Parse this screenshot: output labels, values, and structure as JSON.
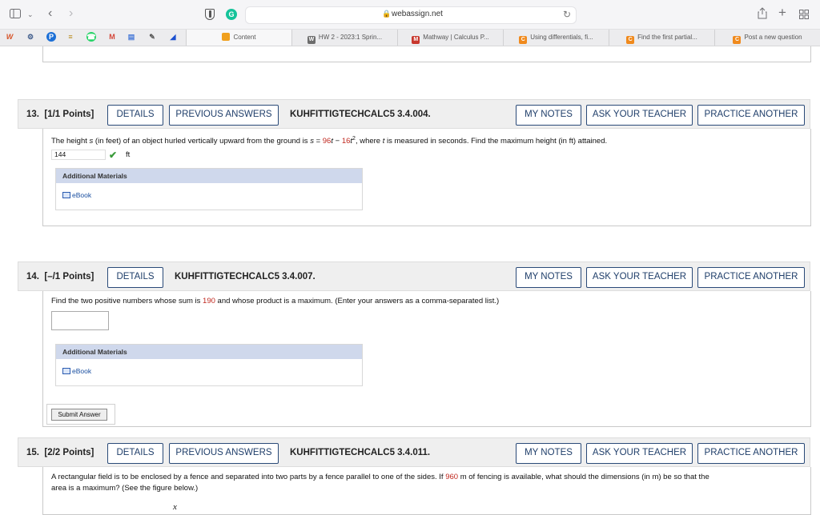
{
  "browser": {
    "url": "webassign.net",
    "tabs": [
      {
        "label": "Content",
        "favicon": "D",
        "color": "#f0a01e"
      },
      {
        "label": "HW 2 - 2023:1 Sprin...",
        "favicon": "W",
        "color": "#6d6d6d"
      },
      {
        "label": "Mathway | Calculus P...",
        "favicon": "M",
        "color": "#c8372d"
      },
      {
        "label": "Using differentials, fi...",
        "favicon": "C",
        "color": "#f08a1d"
      },
      {
        "label": "Find the first partial...",
        "favicon": "C",
        "color": "#f08a1d"
      },
      {
        "label": "Post a new question",
        "favicon": "C",
        "color": "#f08a1d"
      }
    ]
  },
  "questions": [
    {
      "number": "13.",
      "points": "[1/1 Points]",
      "details": "DETAILS",
      "previous_answers": "PREVIOUS ANSWERS",
      "code": "KUHFITTIGTECHCALC5 3.4.004.",
      "my_notes": "MY NOTES",
      "ask_teacher": "ASK YOUR TEACHER",
      "practice": "PRACTICE ANOTHER",
      "text_pre": "The height ",
      "text_var1": "s",
      "text_mid": " (in feet) of an object hurled vertically upward from the ground is ",
      "text_var2": "s",
      "text_eq": " = ",
      "text_red1": "96",
      "text_t1": "t",
      "text_minus": " − ",
      "text_red2": "16",
      "text_t2": "t",
      "text_exp": "2",
      "text_post1": ", where ",
      "text_var3": "t",
      "text_post2": " is measured in seconds. Find the maximum height (in ft) attained.",
      "answer": "144",
      "unit": "ft",
      "additional_materials": "Additional Materials",
      "ebook": "eBook"
    },
    {
      "number": "14.",
      "points": "[–/1 Points]",
      "details": "DETAILS",
      "code": "KUHFITTIGTECHCALC5 3.4.007.",
      "my_notes": "MY NOTES",
      "ask_teacher": "ASK YOUR TEACHER",
      "practice": "PRACTICE ANOTHER",
      "text_pre": "Find the two positive numbers whose sum is ",
      "text_red": "190",
      "text_post": " and whose product is a maximum. (Enter your answers as a comma-separated list.)",
      "answer": "",
      "additional_materials": "Additional Materials",
      "ebook": "eBook",
      "submit": "Submit Answer"
    },
    {
      "number": "15.",
      "points": "[2/2 Points]",
      "details": "DETAILS",
      "previous_answers": "PREVIOUS ANSWERS",
      "code": "KUHFITTIGTECHCALC5 3.4.011.",
      "my_notes": "MY NOTES",
      "ask_teacher": "ASK YOUR TEACHER",
      "practice": "PRACTICE ANOTHER",
      "text_pre": "A rectangular field is to be enclosed by a fence and separated into two parts by a fence parallel to one of the sides. If ",
      "text_red": "960",
      "text_post": " m of fencing is available, what should the dimensions (in m) be so that the",
      "text_line2": "area is a maximum? (See the figure below.)",
      "figure_label": "x"
    }
  ]
}
